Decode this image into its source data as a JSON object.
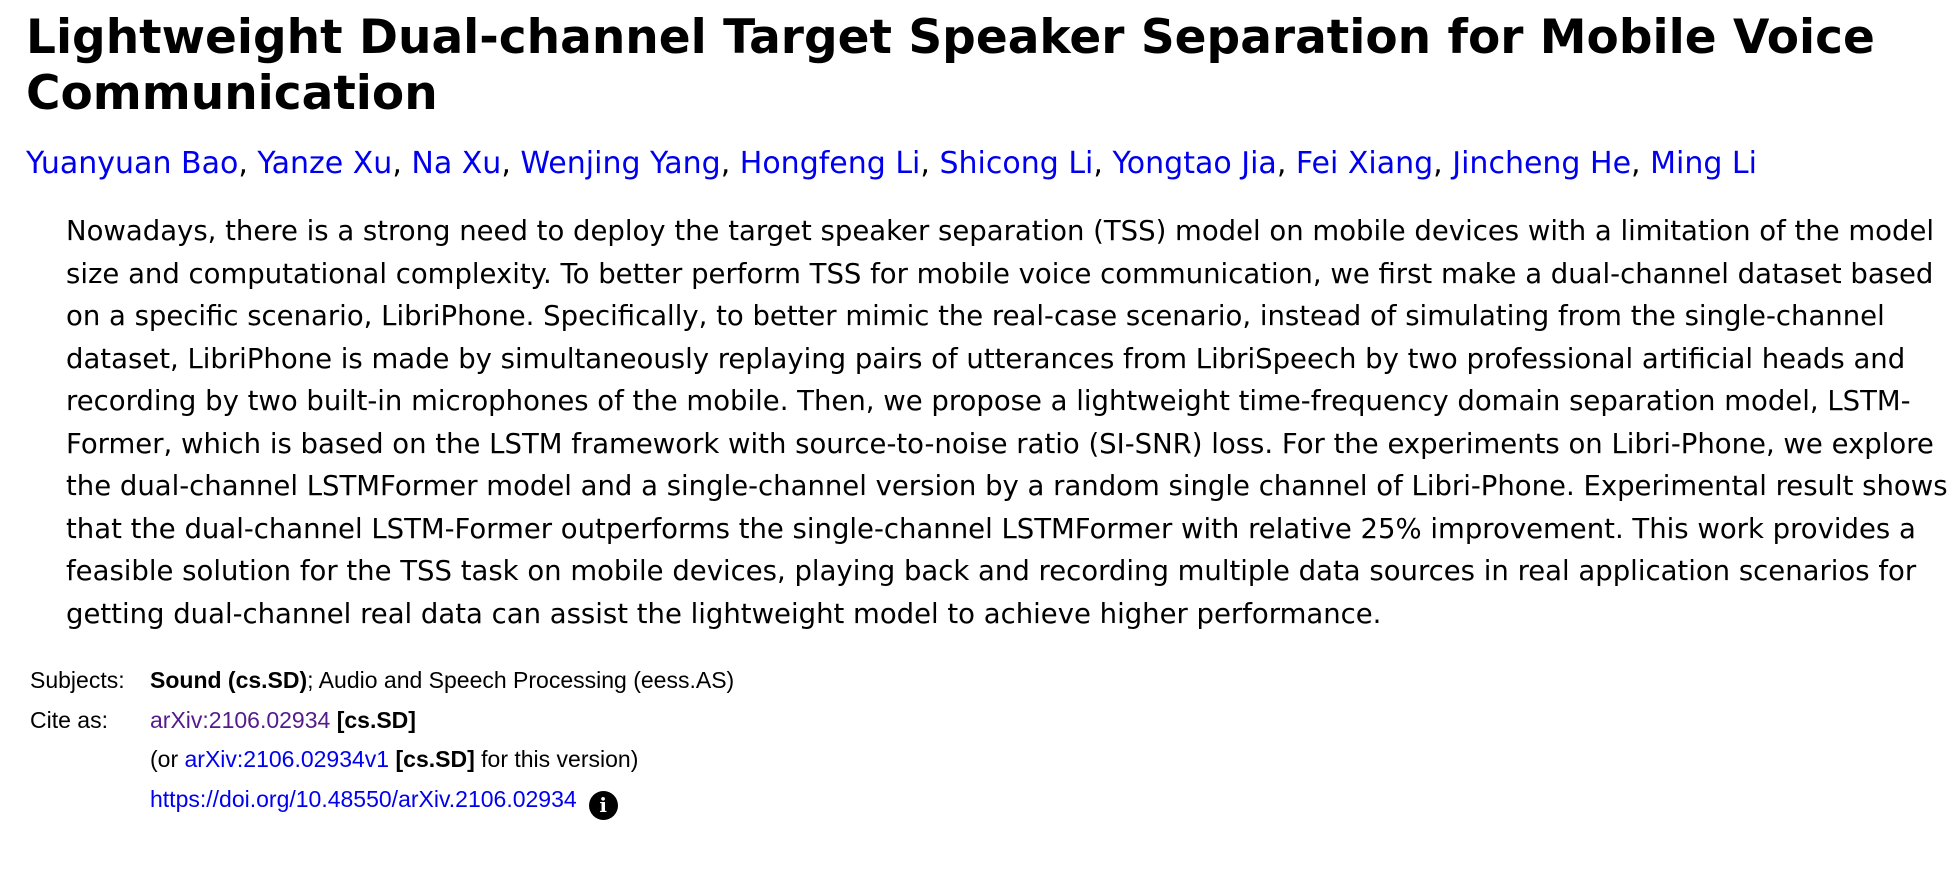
{
  "paper": {
    "title": "Lightweight Dual-channel Target Speaker Separation for Mobile Voice Communication",
    "authors": [
      "Yuanyuan Bao",
      "Yanze Xu",
      "Na Xu",
      "Wenjing Yang",
      "Hongfeng Li",
      "Shicong Li",
      "Yongtao Jia",
      "Fei Xiang",
      "Jincheng He",
      "Ming Li"
    ],
    "author_separator": ", ",
    "abstract": "Nowadays, there is a strong need to deploy the target speaker separation (TSS) model on mobile devices with a limitation of the model size and computational complexity. To better perform TSS for mobile voice communication, we first make a dual-channel dataset based on a specific scenario, LibriPhone. Specifically, to better mimic the real-case scenario, instead of simulating from the single-channel dataset, LibriPhone is made by simultaneously replaying pairs of utterances from LibriSpeech by two professional artificial heads and recording by two built-in microphones of the mobile. Then, we propose a lightweight time-frequency domain separation model, LSTM-Former, which is based on the LSTM framework with source-to-noise ratio (SI-SNR) loss. For the experiments on Libri-Phone, we explore the dual-channel LSTMFormer model and a single-channel version by a random single channel of Libri-Phone. Experimental result shows that the dual-channel LSTM-Former outperforms the single-channel LSTMFormer with relative 25% improvement. This work provides a feasible solution for the TSS task on mobile devices, playing back and recording multiple data sources in real application scenarios for getting dual-channel real data can assist the lightweight model to achieve higher performance."
  },
  "metadata": {
    "subjects_label": "Subjects:",
    "subject_primary": "Sound (cs.SD)",
    "subject_rest": "; Audio and Speech Processing (eess.AS)",
    "cite_label": "Cite as:",
    "cite_id": "arXiv:2106.02934",
    "cite_category": "[cs.SD]",
    "version_prefix": "(or ",
    "version_id": "arXiv:2106.02934v1",
    "version_category": "[cs.SD]",
    "version_suffix": " for this version)",
    "doi_link": "https://doi.org/10.48550/arXiv.2106.02934",
    "info_icon_glyph": "i"
  },
  "colors": {
    "link": "#0000ee",
    "visited_link": "#551a8b",
    "text": "#000000"
  }
}
